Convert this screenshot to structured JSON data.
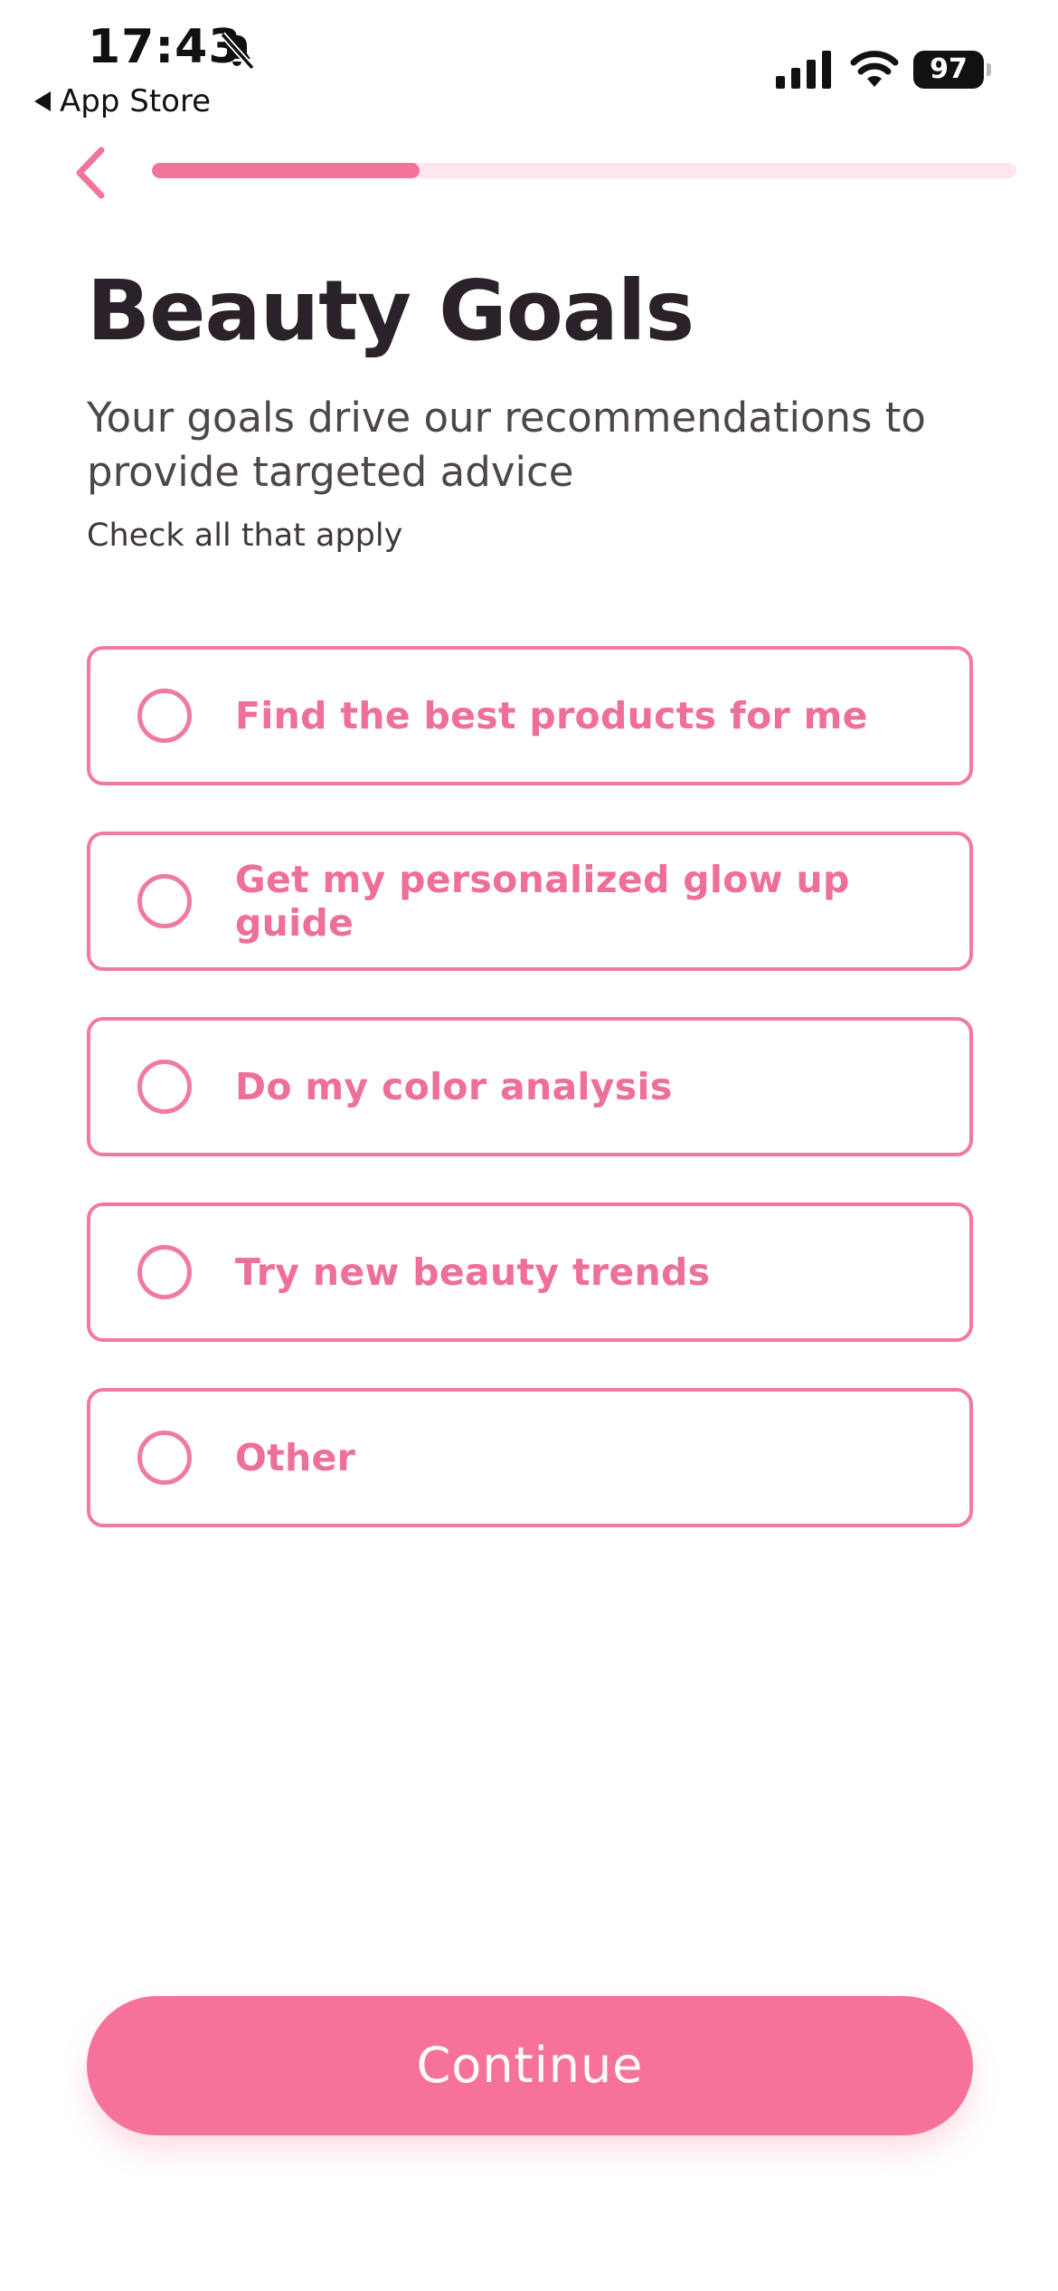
{
  "status_bar": {
    "time": "17:43",
    "back_app": "App Store",
    "battery": "97"
  },
  "progress": {
    "fraction": 0.31
  },
  "header": {
    "title": "Beauty Goals",
    "subtitle": "Your goals drive our recommendations to provide targeted advice",
    "hint": "Check all that apply"
  },
  "options": [
    {
      "label": "Find the best products for me"
    },
    {
      "label": "Get my personalized glow up guide"
    },
    {
      "label": "Do my color analysis"
    },
    {
      "label": "Try new beauty trends"
    },
    {
      "label": "Other"
    }
  ],
  "continue_label": "Continue",
  "colors": {
    "accent": "#f47398",
    "track": "#fde6ec",
    "title": "#2a2228"
  }
}
